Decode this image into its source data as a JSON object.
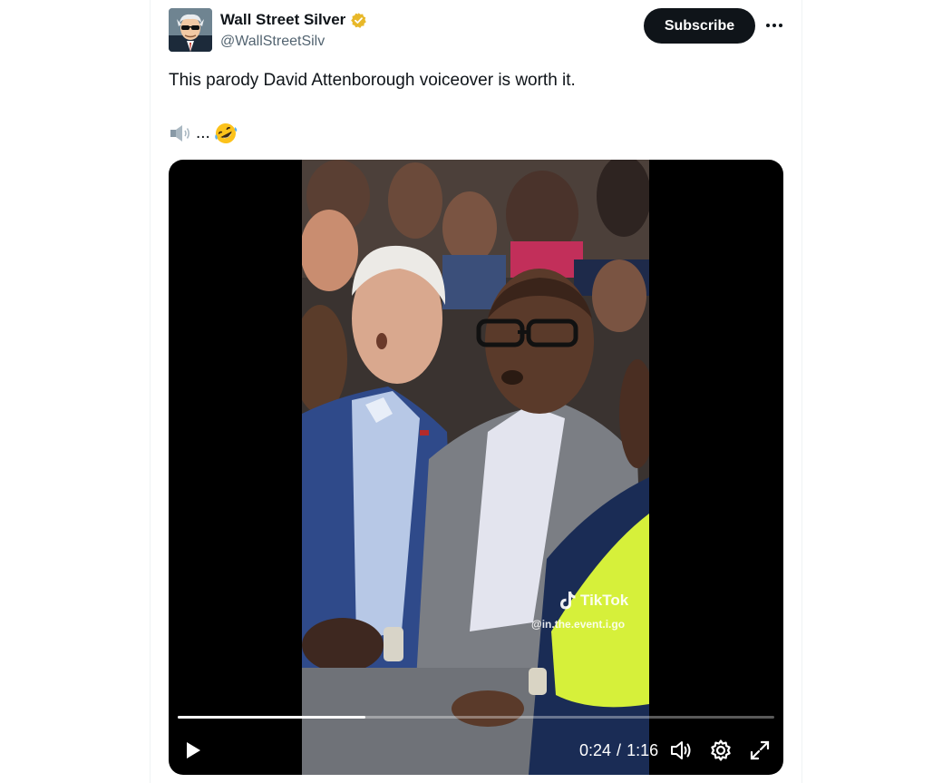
{
  "author": {
    "display_name": "Wall Street Silver",
    "handle": "@WallStreetSilv",
    "verified_badge_color": "#e8b829",
    "avatar_icon": "wall-street-bets-avatar"
  },
  "actions": {
    "subscribe_label": "Subscribe",
    "more_icon": "ellipsis-icon"
  },
  "tweet": {
    "text": "This parody David Attenborough voiceover is worth it.",
    "line2_ellipsis": "...",
    "line2_emojis": [
      "speaker-emoji",
      "rofl-emoji"
    ]
  },
  "video": {
    "watermark_brand": "TikTok",
    "watermark_user": "@in.the.event.i.go",
    "current_time": "0:24",
    "separator": "/",
    "duration": "1:16",
    "progress_fraction": 0.315,
    "controls": [
      "play-icon",
      "volume-icon",
      "gear-icon",
      "fullscreen-icon"
    ]
  },
  "colors": {
    "text_primary": "#0f1419",
    "text_secondary": "#536471",
    "subscribe_bg": "#0f1419",
    "video_bg": "#000000",
    "highlight_yellow": "#d6f03a"
  }
}
